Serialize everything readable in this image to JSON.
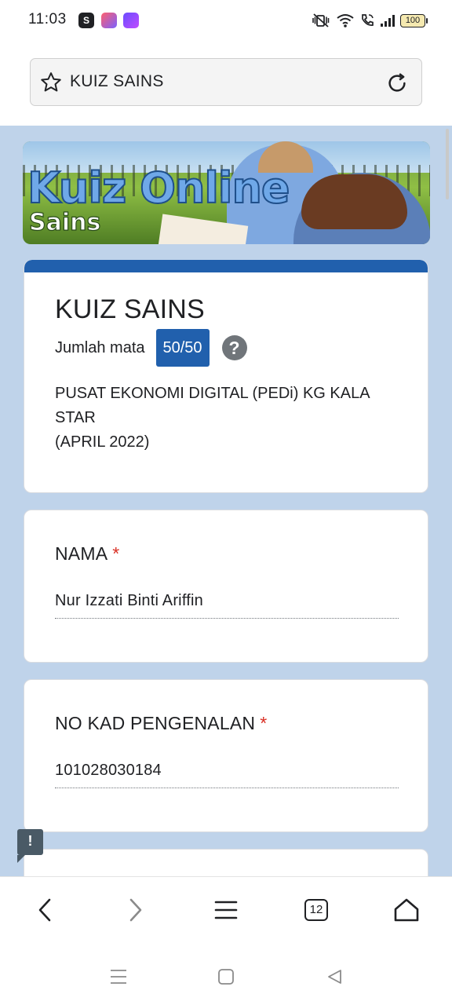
{
  "status_bar": {
    "time": "11:03",
    "app_icons": [
      "shopee-icon",
      "camera-app-icon",
      "game-app-icon"
    ],
    "battery_level": "100"
  },
  "browser": {
    "page_title": "KUIZ SAINS",
    "tab_count": "12"
  },
  "banner": {
    "title": "Kuiz Online",
    "subtitle": "Sains"
  },
  "form": {
    "title": "KUIZ SAINS",
    "score_label": "Jumlah mata",
    "score_value": "50/50",
    "help_symbol": "?",
    "description_line1": "PUSAT EKONOMI DIGITAL (PEDi) KG KALA STAR",
    "description_line2": "(APRIL 2022)",
    "accent_color": "#2160ad",
    "background_color": "#bfd3ea",
    "questions": [
      {
        "label": "NAMA",
        "required_marker": "*",
        "answer": "Nur Izzati Binti Ariffin"
      },
      {
        "label": "NO KAD PENGENALAN",
        "required_marker": "*",
        "answer": "101028030184"
      }
    ]
  },
  "report_button": {
    "symbol": "!"
  }
}
